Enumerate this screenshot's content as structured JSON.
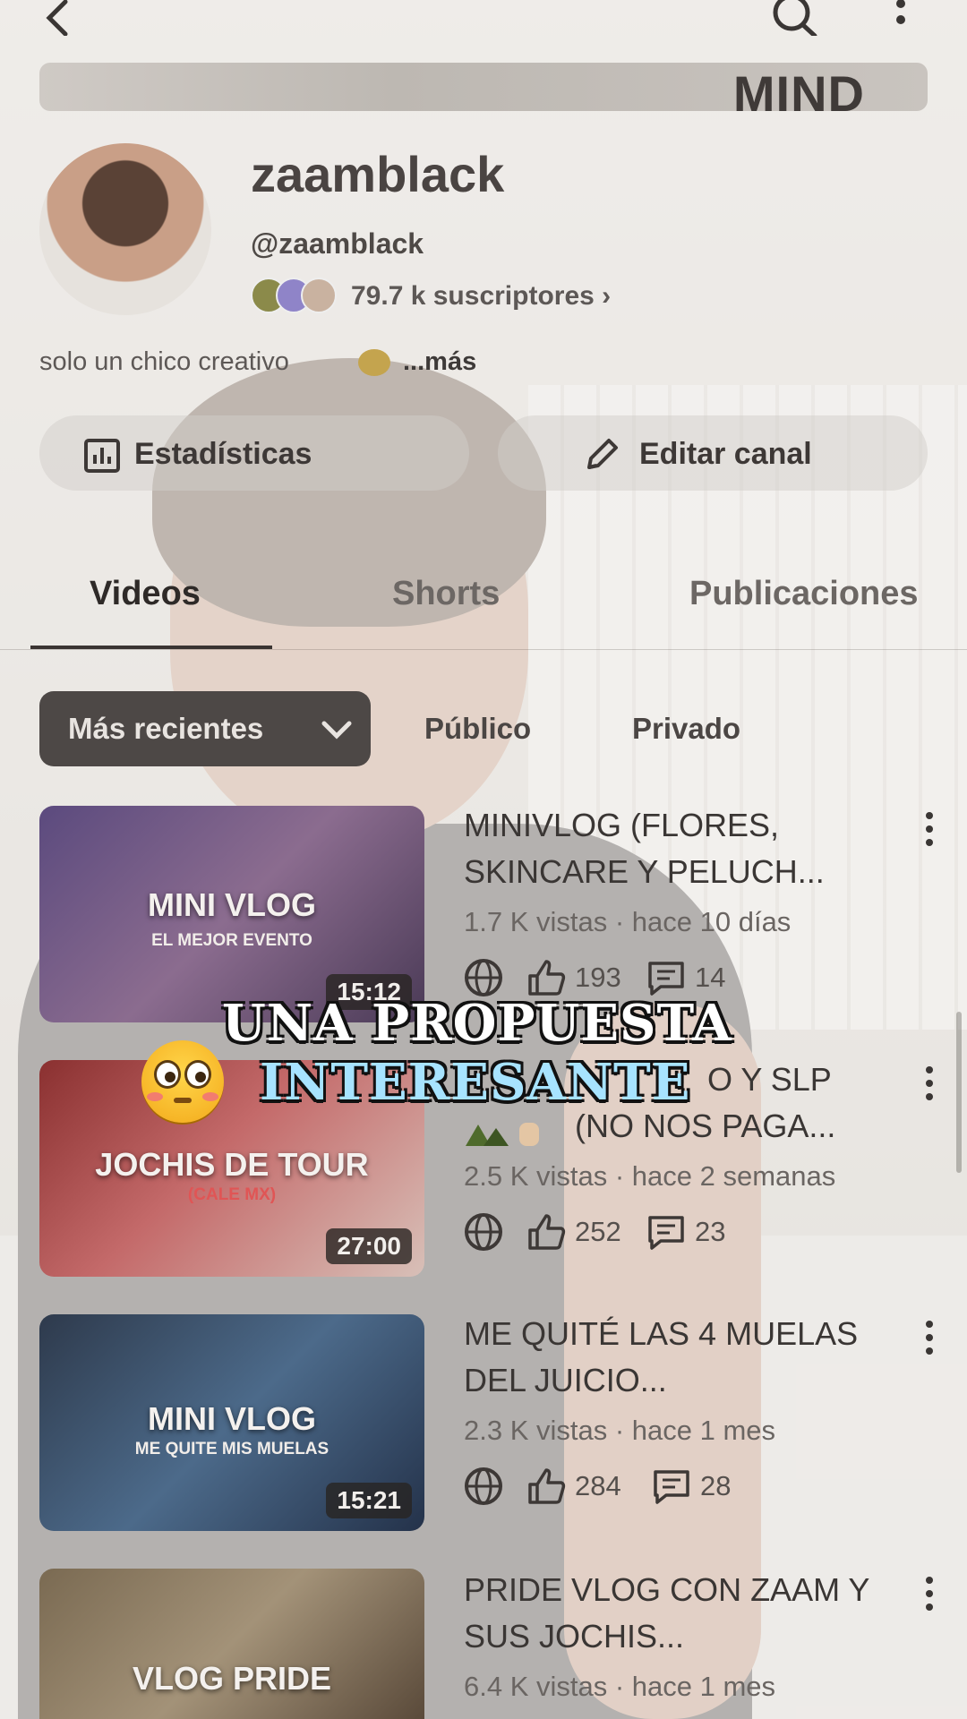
{
  "header": {
    "back_icon": "chevron-left-icon",
    "search_icon": "search-icon",
    "more_icon": "more-vert-icon"
  },
  "banner": {
    "text": "MIND"
  },
  "channel": {
    "name": "zaamblack",
    "handle": "@zaamblack",
    "subscribers": "79.7 k suscriptores ›",
    "bio": "solo un chico creativo",
    "bio_more": "...más"
  },
  "actions": {
    "stats_label": "Estadísticas",
    "edit_label": "Editar canal"
  },
  "tabs": [
    {
      "label": "Videos",
      "active": true
    },
    {
      "label": "Shorts",
      "active": false
    },
    {
      "label": "Publicaciones",
      "active": false
    }
  ],
  "filters": {
    "selected": "Más recientes",
    "options": [
      "Público",
      "Privado"
    ]
  },
  "videos": [
    {
      "thumb_title": "MINI VLOG",
      "thumb_sub": "EL MEJOR EVENTO",
      "duration": "15:12",
      "title": "MINIVLOG (FLORES, SKINCARE Y PELUCH...",
      "meta": "1.7 K vistas · hace 10 días",
      "likes": "193",
      "comments": "14"
    },
    {
      "thumb_title": "JOCHIS DE TOUR",
      "thumb_sub": "(CALE MX)",
      "duration": "27:00",
      "title": "O Y SLP",
      "title2": "(NO NOS PAGA...",
      "meta": "2.5 K vistas · hace 2 semanas",
      "likes": "252",
      "comments": "23"
    },
    {
      "thumb_title": "MINI VLOG",
      "thumb_sub": "ME QUITE MIS MUELAS",
      "duration": "15:21",
      "title": "ME QUITÉ LAS 4 MUELAS DEL JUICIO...",
      "meta": "2.3 K vistas · hace 1 mes",
      "likes": "284",
      "comments": "28"
    },
    {
      "thumb_title": "VLOG PRIDE",
      "thumb_sub": "",
      "duration": "",
      "title": "PRIDE VLOG CON ZAAM Y SUS JOCHIS...",
      "meta": "6.4 K vistas · hace 1 mes",
      "likes": "",
      "comments": ""
    }
  ],
  "overlay": {
    "line1": "UNA PROPUESTA",
    "line2": "INTERESANTE",
    "emoji": "flushed-face-emoji"
  },
  "colors": {
    "overlay_accent": "#a7e3ff",
    "chip_active": "#4d4846"
  }
}
